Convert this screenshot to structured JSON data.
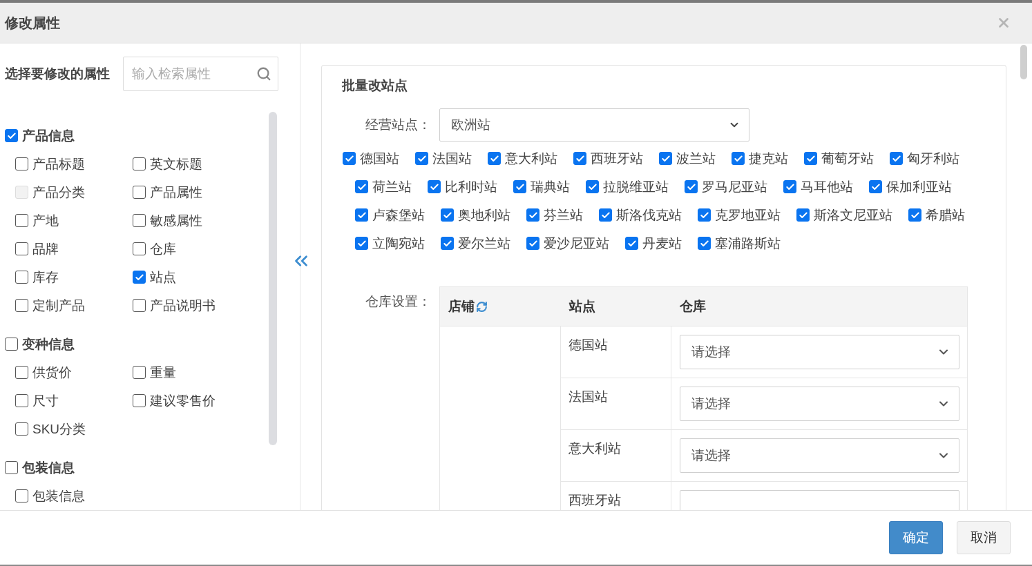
{
  "dialog": {
    "title": "修改属性"
  },
  "attribute_panel": {
    "label": "选择要修改的属性",
    "search": {
      "placeholder": "输入检索属性"
    },
    "groups": [
      {
        "label": "产品信息",
        "checked": true,
        "items": [
          {
            "label": "产品标题",
            "checked": false,
            "disabled": false
          },
          {
            "label": "英文标题",
            "checked": false,
            "disabled": false
          },
          {
            "label": "产品分类",
            "checked": false,
            "disabled": true
          },
          {
            "label": "产品属性",
            "checked": false,
            "disabled": false
          },
          {
            "label": "产地",
            "checked": false,
            "disabled": false
          },
          {
            "label": "敏感属性",
            "checked": false,
            "disabled": false
          },
          {
            "label": "品牌",
            "checked": false,
            "disabled": false
          },
          {
            "label": "仓库",
            "checked": false,
            "disabled": false
          },
          {
            "label": "库存",
            "checked": false,
            "disabled": false
          },
          {
            "label": "站点",
            "checked": true,
            "disabled": false
          },
          {
            "label": "定制产品",
            "checked": false,
            "disabled": false
          },
          {
            "label": "产品说明书",
            "checked": false,
            "disabled": false
          }
        ]
      },
      {
        "label": "变种信息",
        "checked": false,
        "items": [
          {
            "label": "供货价",
            "checked": false,
            "disabled": false
          },
          {
            "label": "重量",
            "checked": false,
            "disabled": false
          },
          {
            "label": "尺寸",
            "checked": false,
            "disabled": false
          },
          {
            "label": "建议零售价",
            "checked": false,
            "disabled": false
          },
          {
            "label": "SKU分类",
            "checked": false,
            "disabled": false
          }
        ]
      },
      {
        "label": "包装信息",
        "checked": false,
        "items": [
          {
            "label": "包装信息",
            "checked": false,
            "disabled": false
          }
        ]
      }
    ]
  },
  "site_card": {
    "title": "批量改站点",
    "site_field": {
      "label": "经营站点：",
      "value": "欧洲站"
    },
    "stations": [
      {
        "label": "德国站",
        "checked": true
      },
      {
        "label": "法国站",
        "checked": true
      },
      {
        "label": "意大利站",
        "checked": true
      },
      {
        "label": "西班牙站",
        "checked": true
      },
      {
        "label": "波兰站",
        "checked": true
      },
      {
        "label": "捷克站",
        "checked": true
      },
      {
        "label": "葡萄牙站",
        "checked": true
      },
      {
        "label": "匈牙利站",
        "checked": true
      },
      {
        "label": "荷兰站",
        "checked": true
      },
      {
        "label": "比利时站",
        "checked": true
      },
      {
        "label": "瑞典站",
        "checked": true
      },
      {
        "label": "拉脱维亚站",
        "checked": true
      },
      {
        "label": "罗马尼亚站",
        "checked": true
      },
      {
        "label": "马耳他站",
        "checked": true
      },
      {
        "label": "保加利亚站",
        "checked": true
      },
      {
        "label": "卢森堡站",
        "checked": true
      },
      {
        "label": "奥地利站",
        "checked": true
      },
      {
        "label": "芬兰站",
        "checked": true
      },
      {
        "label": "斯洛伐克站",
        "checked": true
      },
      {
        "label": "克罗地亚站",
        "checked": true
      },
      {
        "label": "斯洛文尼亚站",
        "checked": true
      },
      {
        "label": "希腊站",
        "checked": true
      },
      {
        "label": "立陶宛站",
        "checked": true
      },
      {
        "label": "爱尔兰站",
        "checked": true
      },
      {
        "label": "爱沙尼亚站",
        "checked": true
      },
      {
        "label": "丹麦站",
        "checked": true
      },
      {
        "label": "塞浦路斯站",
        "checked": true
      }
    ],
    "warehouse": {
      "label": "仓库设置：",
      "columns": [
        "店铺",
        "站点",
        "仓库"
      ],
      "rows": [
        {
          "station": "德国站",
          "value": "请选择"
        },
        {
          "station": "法国站",
          "value": "请选择"
        },
        {
          "station": "意大利站",
          "value": "请选择"
        },
        {
          "station": "西班牙站"
        }
      ]
    }
  },
  "footer": {
    "buttons": [
      {
        "label": "确定",
        "kind": "primary"
      },
      {
        "label": "取消",
        "kind": "default"
      }
    ]
  }
}
